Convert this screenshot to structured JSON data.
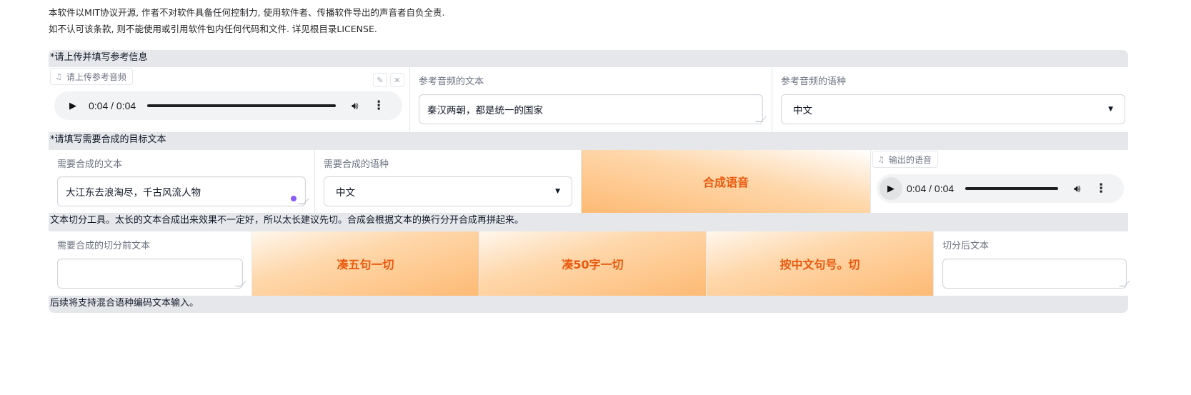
{
  "notice": {
    "line1": "本软件以MIT协议开源, 作者不对软件具备任何控制力, 使用软件者、传播软件导出的声音者自负全责.",
    "line2": "如不认可该条款, 则不能使用或引用软件包内任何代码和文件. 详见根目录LICENSE."
  },
  "reference": {
    "section_label": "*请上传并填写参考信息",
    "audio_label": "请上传参考音频",
    "audio_time": "0:04 / 0:04",
    "text_label": "参考音频的文本",
    "text_value": "秦汉两朝，都是统一的国家",
    "lang_label": "参考音频的语种",
    "lang_value": "中文"
  },
  "target": {
    "section_label": "*请填写需要合成的目标文本",
    "text_label": "需要合成的文本",
    "text_value": "大江东去浪淘尽，千古风流人物",
    "lang_label": "需要合成的语种",
    "lang_value": "中文",
    "synth_button": "合成语音",
    "output_label": "输出的语音",
    "output_time": "0:04 / 0:04"
  },
  "splitter": {
    "section_label": "文本切分工具。太长的文本合成出来效果不一定好，所以太长建议先切。合成会根据文本的换行分开合成再拼起来。",
    "input_label": "需要合成的切分前文本",
    "input_value": "",
    "btn_five": "凑五句一切",
    "btn_fifty": "凑50字一切",
    "btn_period": "按中文句号。切",
    "output_label": "切分后文本",
    "output_value": ""
  },
  "footer": {
    "label": "后续将支持混合语种编码文本输入。"
  },
  "icons": [
    "music-note-icon",
    "edit-icon",
    "close-icon",
    "play-icon",
    "volume-icon",
    "more-vert-icon",
    "dropdown-caret-icon"
  ],
  "colors": {
    "accent": "#ea580c",
    "button_gradient_light": "#fff7ed",
    "button_gradient_dark": "#fdba74",
    "panel_bg": "#e5e7eb",
    "focus_dot": "#8b5cf6"
  }
}
